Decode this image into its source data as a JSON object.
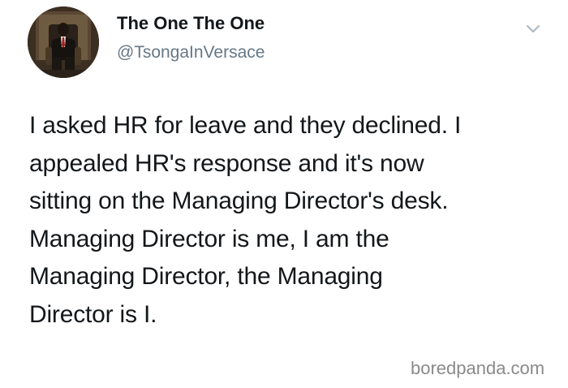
{
  "tweet": {
    "display_name": "The One The One",
    "handle": "@TsongaInVersace",
    "lines": [
      "I asked HR for leave and they declined. I",
      "appealed HR's response and it's now",
      "sitting on the Managing Director's desk.",
      "Managing Director is me, I am the",
      "Managing Director, the Managing",
      "Director is I."
    ]
  },
  "icons": {
    "avatar": "profile-photo",
    "menu": "chevron-down-icon"
  },
  "watermark": {
    "text": "boredpanda.com"
  },
  "colors": {
    "text": "#14171a",
    "secondary": "#657786",
    "chevron": "#aab8c2",
    "watermark": "#8a8a8a"
  }
}
